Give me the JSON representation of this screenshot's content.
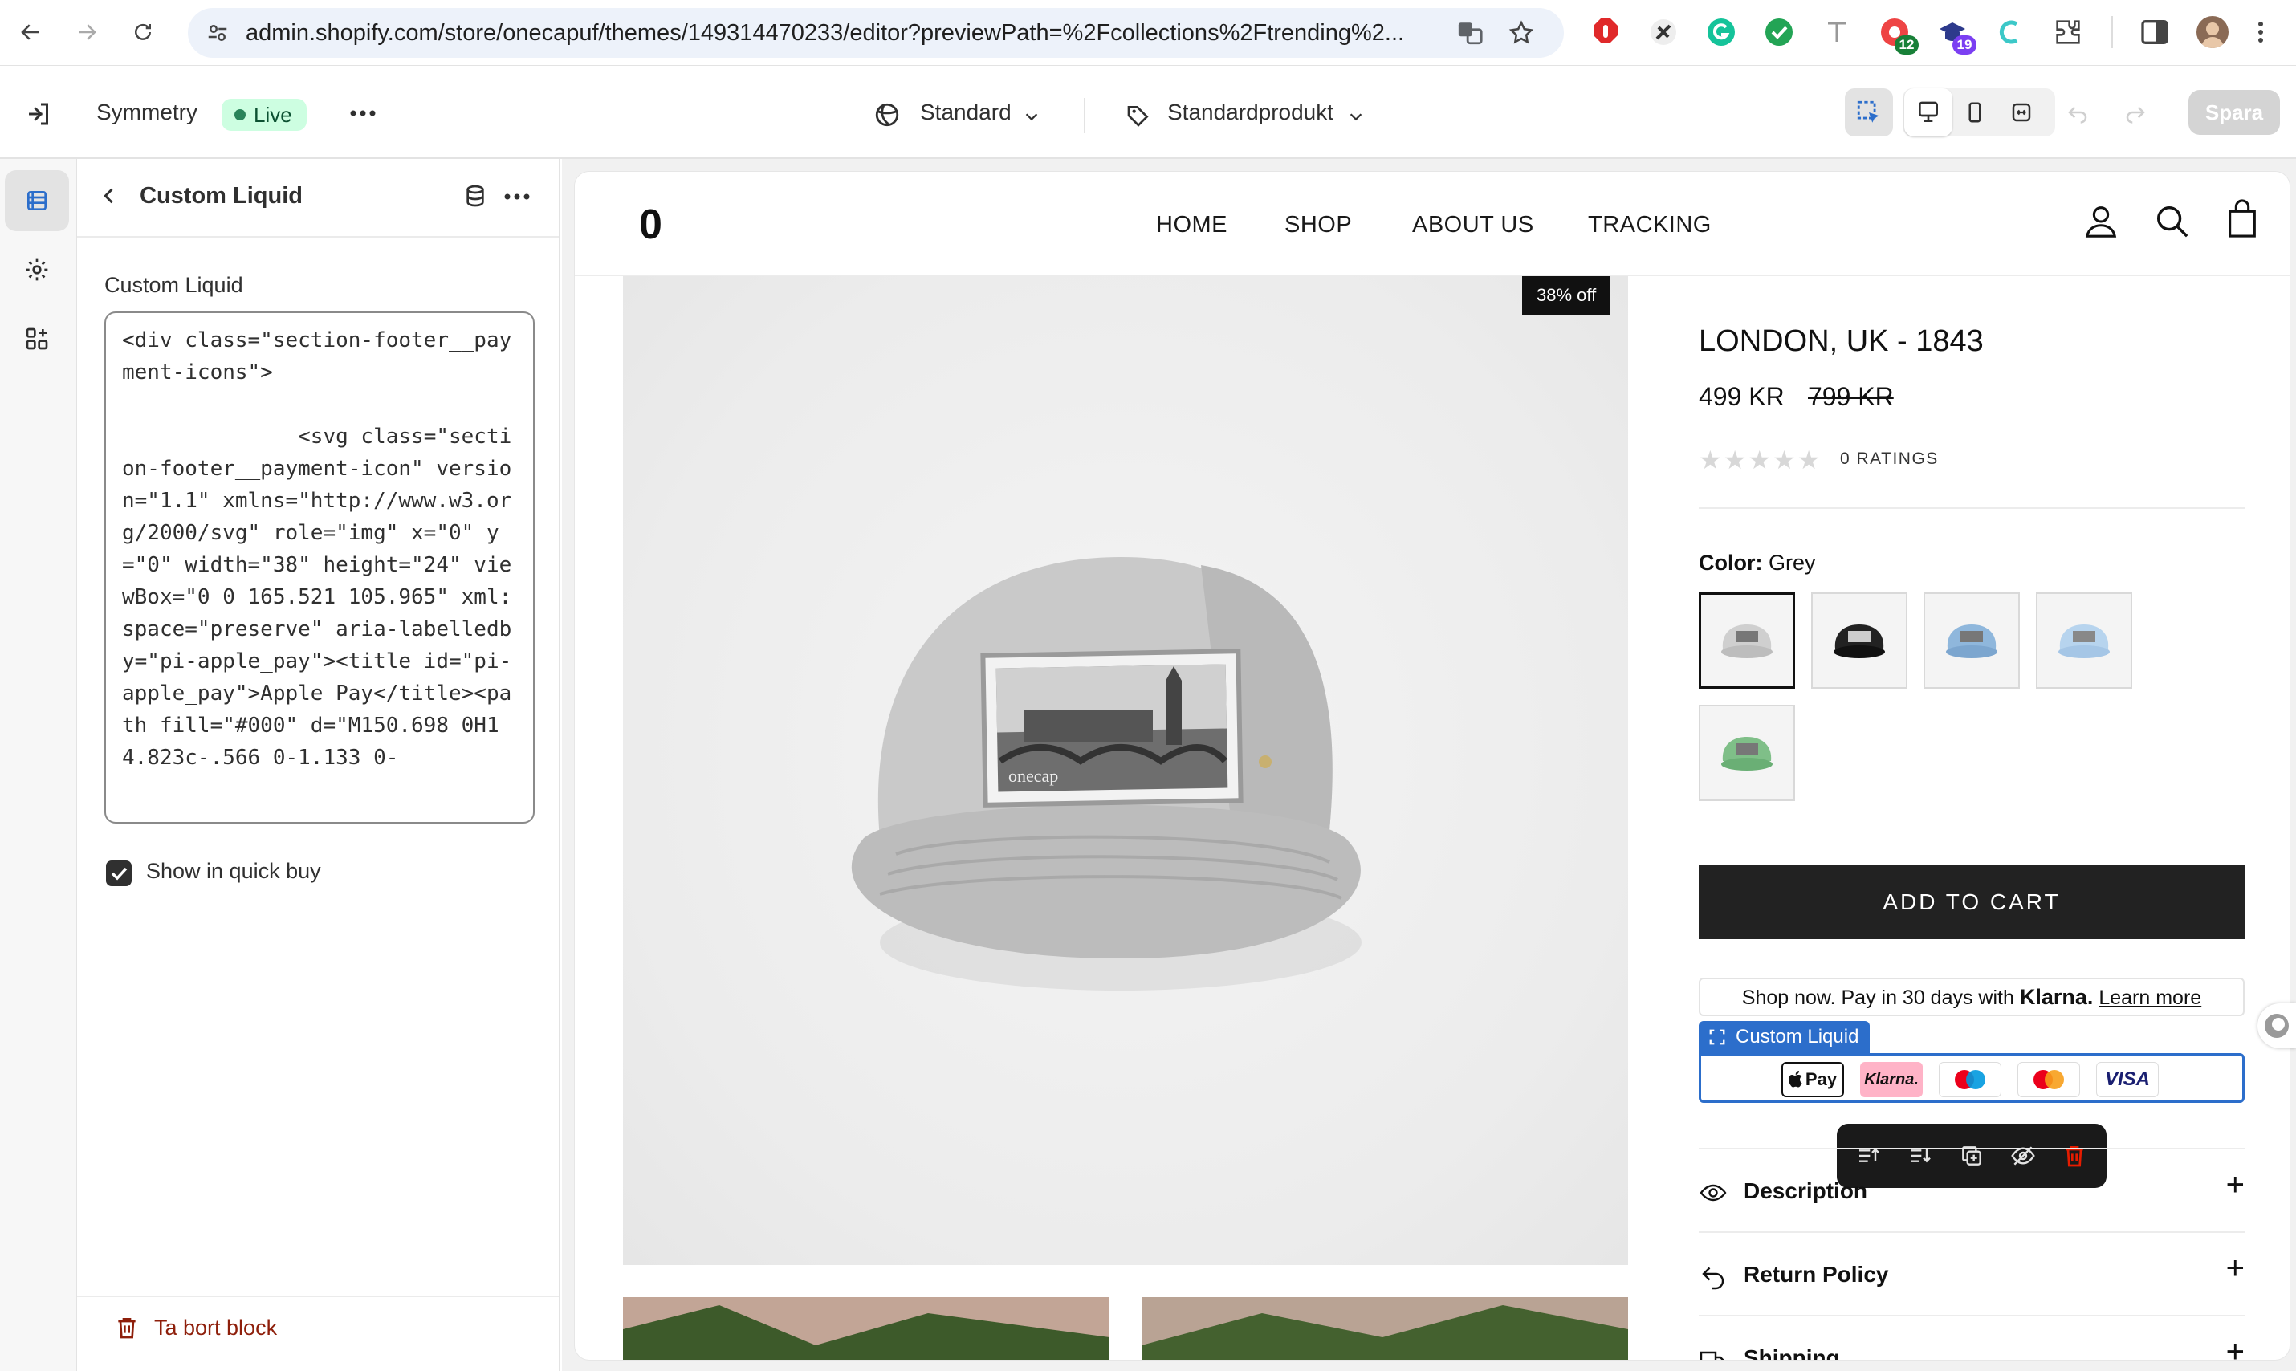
{
  "browser": {
    "url": "admin.shopify.com/store/onecapuf/themes/149314470233/editor?previewPath=%2Fcollections%2Ftrending%2...",
    "extension_badges": [
      "12",
      "19"
    ]
  },
  "editor": {
    "theme_name": "Symmetry",
    "status_badge": "Live",
    "template_selector": "Standard",
    "product_selector": "Standardprodukt",
    "save_label": "Spara"
  },
  "panel": {
    "title": "Custom Liquid",
    "field_label": "Custom Liquid",
    "code": "<div class=\"section-footer__payment-icons\">\n\n              <svg class=\"section-footer__payment-icon\" version=\"1.1\" xmlns=\"http://www.w3.org/2000/svg\" role=\"img\" x=\"0\" y=\"0\" width=\"38\" height=\"24\" viewBox=\"0 0 165.521 105.965\" xml:space=\"preserve\" aria-labelledby=\"pi-apple_pay\"><title id=\"pi-apple_pay\">Apple Pay</title><path fill=\"#000\" d=\"M150.698 0H14.823c-.566 0-1.133 0-",
    "checkbox_label": "Show in quick buy",
    "checkbox_checked": true,
    "remove_label": "Ta bort block"
  },
  "store": {
    "logo": "0",
    "menu": [
      "HOME",
      "SHOP",
      "ABOUT US",
      "TRACKING"
    ],
    "sale_badge": "38% off",
    "product_title": "LONDON, UK - 1843",
    "price": "499 KR",
    "compare_price": "799 KR",
    "stars": "★★★★★",
    "ratings": "0 RATINGS",
    "color_label": "Color:",
    "color_value": "Grey",
    "swatches": [
      "grey",
      "black",
      "blue",
      "light-blue",
      "green"
    ],
    "add_to_cart": "ADD TO CART",
    "klarna_text": "Shop now. Pay in 30 days with",
    "klarna_brand": "Klarna.",
    "klarna_link": "Learn more",
    "custom_liquid_tag": "Custom Liquid",
    "payment_icons": [
      "Apple Pay",
      "Klarna.",
      "Maestro",
      "Mastercard",
      "VISA"
    ],
    "apple_pay_text": "Pay",
    "klarna_icon_text": "Klarna.",
    "visa_text": "VISA",
    "accordion": [
      "Description",
      "Return Policy",
      "Shipping"
    ],
    "cap_patch_text": "onecap"
  },
  "colors": {
    "live_bg": "#cdfee1",
    "selection_blue": "#2c6ecb",
    "danger": "#e51c00",
    "add_to_cart_bg": "#222222"
  }
}
